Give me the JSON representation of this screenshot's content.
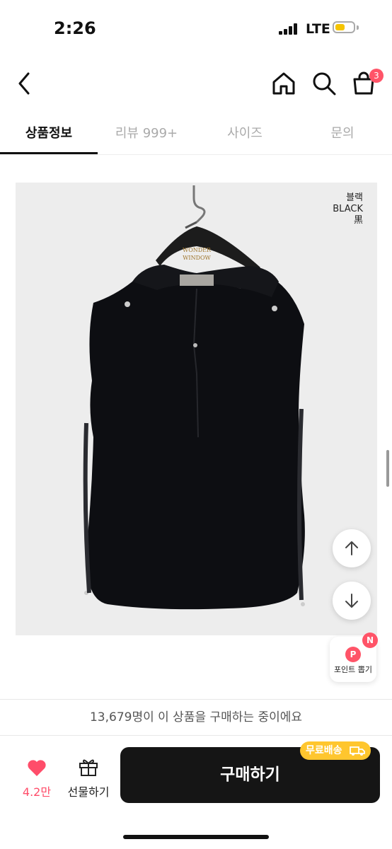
{
  "status_bar": {
    "time": "2:26",
    "network": "LTE",
    "battery_level": 0.55
  },
  "nav": {
    "cart_badge": "3",
    "icons": [
      "back-icon",
      "home-icon",
      "search-icon",
      "cart-icon"
    ]
  },
  "tabs": [
    {
      "label": "상품정보",
      "active": true
    },
    {
      "label": "리뷰 999+",
      "active": false
    },
    {
      "label": "사이즈",
      "active": false
    },
    {
      "label": "문의",
      "active": false
    }
  ],
  "product_image": {
    "color_label": [
      "블랙",
      "BLACK",
      "黒"
    ],
    "hanger_tag": [
      "WONDER",
      "WINDOW"
    ]
  },
  "floating": {
    "point_icon_letter": "P",
    "point_label": "포인트 뽑기",
    "point_new_badge": "N",
    "icons": [
      "arrow-up-icon",
      "arrow-down-icon"
    ]
  },
  "buyers_text": "13,679명이 이 상품을 구매하는 중이에요",
  "bottom_bar": {
    "like_count": "4.2만",
    "gift_label": "선물하기",
    "buy_label": "구매하기",
    "shipping_tag": "무료배송"
  },
  "colors": {
    "accent": "#ff5468",
    "buy_button": "#151515",
    "shipping_tag": "#ffc62e"
  }
}
